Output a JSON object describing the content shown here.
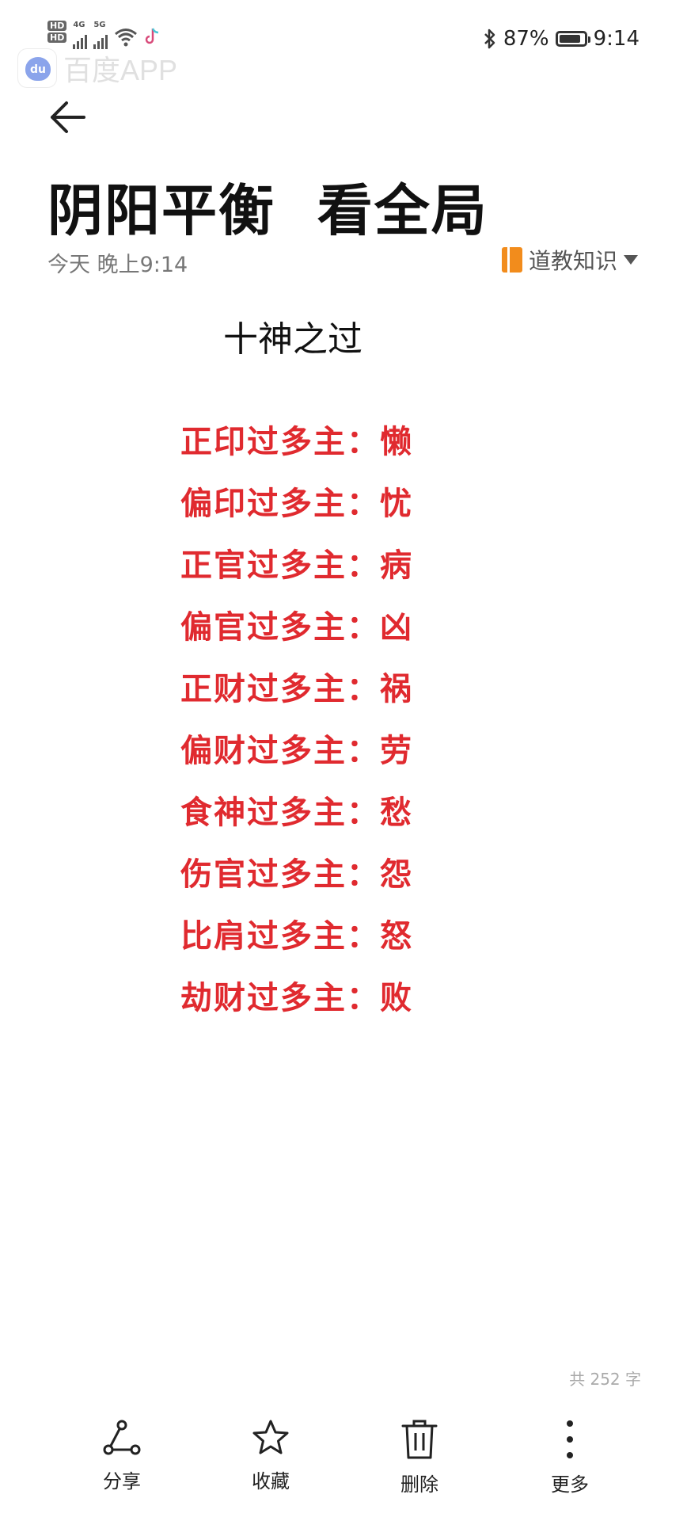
{
  "status_bar": {
    "hd1": "HD",
    "net1": "4G",
    "hd2": "HD",
    "net2": "5G",
    "battery_percent": "87%",
    "battery_level": 0.87,
    "time": "9:14"
  },
  "overlay": {
    "app_label": "百度APP",
    "logo_text": "du"
  },
  "header": {
    "title": "阴阳平衡  看全局",
    "timestamp": "今天 晚上9:14",
    "category": "道教知识"
  },
  "content": {
    "heading": "十神之过",
    "lines": [
      "正印过多主：懒",
      "偏印过多主：忧",
      "正官过多主：病",
      "偏官过多主：凶",
      "正财过多主：祸",
      "偏财过多主：劳",
      "食神过多主：愁",
      "伤官过多主：怨",
      "比肩过多主：怒",
      "劫财过多主：败"
    ],
    "text_color": "#e02a2f"
  },
  "footer": {
    "word_count": "共 252 字"
  },
  "toolbar": {
    "share_label": "分享",
    "favorite_label": "收藏",
    "delete_label": "删除",
    "more_label": "更多"
  },
  "icons": {
    "back": "back-arrow-icon",
    "share": "share-icon",
    "favorite": "star-icon",
    "delete": "trash-icon",
    "more": "more-vertical-icon",
    "category": "folder-icon"
  }
}
